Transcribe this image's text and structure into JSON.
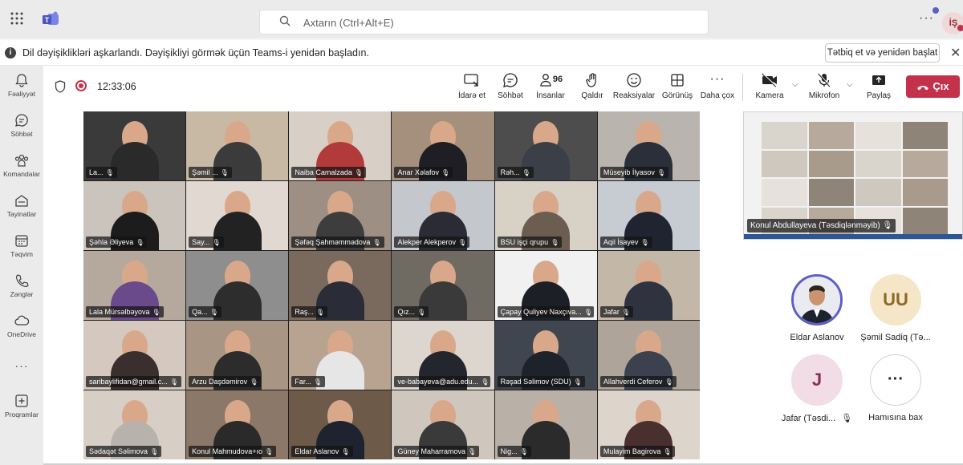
{
  "titlebar": {
    "search_placeholder": "Axtarın (Ctrl+Alt+E)",
    "more": "···",
    "avatar_initials": "İŞ"
  },
  "banner": {
    "message": "Dil dəyişiklikləri aşkarlandı. Dəyişikliyi görmək üçün Teams-i yenidən başladın.",
    "restart_button": "Tətbiq et və yenidən başlat"
  },
  "rail": [
    {
      "label": "Fəaliyyət",
      "icon": "bell-icon"
    },
    {
      "label": "Söhbət",
      "icon": "chat-icon"
    },
    {
      "label": "Komandalar",
      "icon": "teams-icon"
    },
    {
      "label": "Tayinatlar",
      "icon": "assignments-icon"
    },
    {
      "label": "Təqvim",
      "icon": "calendar-icon"
    },
    {
      "label": "Zənglər",
      "icon": "phone-icon"
    },
    {
      "label": "OneDrive",
      "icon": "cloud-icon"
    },
    {
      "label": "···",
      "icon": "more-icon"
    },
    {
      "label": "Proqramlar",
      "icon": "apps-icon"
    }
  ],
  "meeting": {
    "time": "12:33:06",
    "controls": {
      "share": "İdarə et",
      "chat": "Söhbət",
      "people": "İnsanlar",
      "people_count": "96",
      "raise": "Qaldır",
      "react": "Reaksiyalar",
      "view": "Görünüş",
      "more": "Daha çox",
      "camera": "Kamera",
      "mic": "Mikrofon",
      "present": "Paylaş",
      "leave": "Çıx"
    }
  },
  "participants": [
    {
      "name": "La...",
      "bg": "#3a3a3a",
      "shirt": "#2a2a2a"
    },
    {
      "name": "Şəmil ...",
      "bg": "#c8b9a5",
      "shirt": "#3b3b3b"
    },
    {
      "name": "Naiba Camalzada",
      "bg": "#d8cfc7",
      "shirt": "#b33a3a"
    },
    {
      "name": "Anar Xəlafov",
      "bg": "#a58f7d",
      "shirt": "#1e1e24"
    },
    {
      "name": "Rəh...",
      "bg": "#4d4d4d",
      "shirt": "#3a3f48"
    },
    {
      "name": "Müseyib İlyasov",
      "bg": "#b9b4ad",
      "shirt": "#2b2f3a"
    },
    {
      "name": "Şəhla Əliyeva",
      "bg": "#cac4bc",
      "shirt": "#1c1c1c"
    },
    {
      "name": "Say...",
      "bg": "#e0d8d1",
      "shirt": "#222222"
    },
    {
      "name": "Şəfəq Şahməmmədova",
      "bg": "#9d8f84",
      "shirt": "#3d3d3d"
    },
    {
      "name": "Alekper Alekperov",
      "bg": "#c4c7cc",
      "shirt": "#2b2b35"
    },
    {
      "name": "BSU işçi qrupu",
      "bg": "#d8d2c6",
      "shirt": "#6b5d4f"
    },
    {
      "name": "Aqil İsayev",
      "bg": "#c7ccd3",
      "shirt": "#1f2430"
    },
    {
      "name": "Lala Mürsəlbəyova",
      "bg": "#b5a99e",
      "shirt": "#6a4a8a"
    },
    {
      "name": "Qa...",
      "bg": "#8e8e8e",
      "shirt": "#2d2d2d"
    },
    {
      "name": "Raş...",
      "bg": "#7a6a5e",
      "shirt": "#2a2d38"
    },
    {
      "name": "Qız...",
      "bg": "#6f6a62",
      "shirt": "#3a3a3a"
    },
    {
      "name": "Çapay Quliyev Naxçıva...",
      "bg": "#f1f1f1",
      "shirt": "#1d1f27"
    },
    {
      "name": "Jafar",
      "bg": "#c3b7a8",
      "shirt": "#2f3340"
    },
    {
      "name": "saribaylifidan@gmail.c...",
      "bg": "#d4c8bf",
      "shirt": "#3a2e2e"
    },
    {
      "name": "Arzu Daşdəmirov",
      "bg": "#a89583",
      "shirt": "#2c2c2c"
    },
    {
      "name": "Far...",
      "bg": "#b8a390",
      "shirt": "#e6e6e6"
    },
    {
      "name": "ve-babayeva@adu.edu...",
      "bg": "#dcd6cf",
      "shirt": "#24262d"
    },
    {
      "name": "Rəşad Səlimov (SDU)",
      "bg": "#3f4650",
      "shirt": "#1d222b"
    },
    {
      "name": "Allahverdi Ceferov",
      "bg": "#aea49a",
      "shirt": "#3c4150"
    },
    {
      "name": "Sədaqət Səlimova",
      "bg": "#d7cfc6",
      "shirt": "#b7b2ab"
    },
    {
      "name": "Konul Mahmudova+ıo",
      "bg": "#8b7868",
      "shirt": "#2a2a2a"
    },
    {
      "name": "Eldar Aslanov",
      "bg": "#6e5a48",
      "shirt": "#1f2330"
    },
    {
      "name": "Güney Maharramova",
      "bg": "#cfc6bd",
      "shirt": "#3a3a3a"
    },
    {
      "name": "Nig...",
      "bg": "#b9b1a7",
      "shirt": "#2b2b2b"
    },
    {
      "name": "Mulayim Bagirova",
      "bg": "#ddd5cb",
      "shirt": "#4a2f2f"
    }
  ],
  "screen_share": {
    "presenter": "Konul Abdullayeva (Təsdiqlənməyib)"
  },
  "roster": [
    {
      "name": "Eldar Aslanov",
      "initials": "",
      "bg": "#5a6478",
      "fg": "#ffffff",
      "ring": "#5b5fc7"
    },
    {
      "name": "Şəmil Sadiq (Tə...",
      "initials": "UU",
      "bg": "#f5e6c8",
      "fg": "#8a6a24",
      "ring": ""
    },
    {
      "name": "Jafar (Təsdi...",
      "initials": "J",
      "bg": "#f2dde6",
      "fg": "#8a2d55",
      "ring": ""
    },
    {
      "name": "Hamısına bax",
      "initials": "···",
      "bg": "#ffffff",
      "fg": "#242424",
      "ring": "#d1d1d1"
    }
  ],
  "colors": {
    "accent": "#5b5fc7",
    "leave": "#c4314b",
    "rail": "#ebebeb"
  }
}
